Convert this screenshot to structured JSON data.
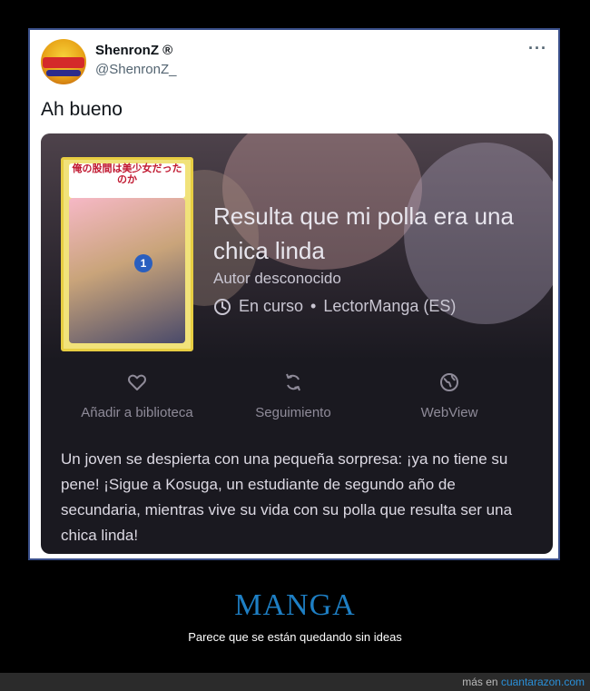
{
  "tweet": {
    "display_name": "ShenronZ ®",
    "handle": "@ShenronZ_",
    "more_icon": "more-dots-icon",
    "text": "Ah bueno"
  },
  "manga_card": {
    "cover_title": "俺の股間は美少女だったのか",
    "cover_volume": "1",
    "title": "Resulta que mi polla era una chica linda",
    "author": "Autor desconocido",
    "status": "En curso",
    "separator": "•",
    "source": "LectorManga (ES)",
    "actions": [
      {
        "label": "Añadir a biblioteca",
        "icon": "heart-icon"
      },
      {
        "label": "Seguimiento",
        "icon": "sync-icon"
      },
      {
        "label": "WebView",
        "icon": "globe-icon"
      }
    ],
    "description": "Un joven se despierta con una pequeña sorpresa: ¡ya no tiene su pene! ¡Sigue a Kosuga, un estudiante de segundo año de secundaria, mientras vive su vida con su polla que resulta ser una chica linda!"
  },
  "site": {
    "category": "MANGA",
    "subtitle": "Parece que se están quedando sin ideas",
    "footer_prefix": "más en",
    "footer_link": "cuantarazon.com"
  },
  "colors": {
    "accent": "#1e7fc4",
    "card_bg": "#1a1920",
    "frame_border": "#3a4f8a"
  }
}
